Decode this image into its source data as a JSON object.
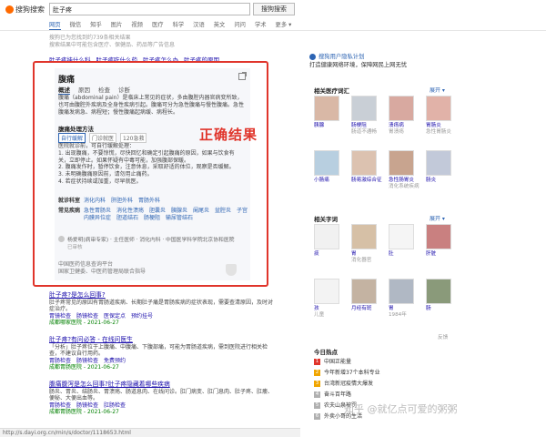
{
  "header": {
    "logo_text": "搜狗搜索",
    "search_value": "肚子疼",
    "search_button": "搜狗搜索",
    "tabs": [
      "网页",
      "微信",
      "知乎",
      "图片",
      "视频",
      "医疗",
      "科学",
      "汉语",
      "英文",
      "问问",
      "学术",
      "更多 ▾"
    ]
  },
  "notice": {
    "line1": "搜狗已为您找到约739条相关结果",
    "line2": "搜索结果中可能包含医疗、保健品、药品等广告信息",
    "links": [
      "肚子疼挂什么科",
      "肚子疼吃什么药",
      "肚子疼怎么办",
      "肚子疼的原因"
    ]
  },
  "card": {
    "title": "腹痛",
    "tabs": [
      "概述",
      "原因",
      "检查",
      "诊断"
    ],
    "desc": "腹痛（abdominal pain）是临床上常见的症状，多由腹腔内器官病变所致，也可由腹腔外疾病及全身性疾病引起。腹痛可分为急性腹痛与慢性腹痛。急性腹痛发病急、病程短；慢性腹痛起病缓、病程长。",
    "section_title": "腹痛处理方法",
    "pills": [
      "自行缓解",
      "门诊就医",
      "120急救"
    ],
    "body": "医院就诊前，可自行缓解处理：\n1. 出现腹痛，不要惊慌，尽快回忆和确定引起腹痛的原因，如果与饮食有关，立即停止。如果怀疑有中毒可能，加强腹部保暖。\n2. 腹痛发作时，暂停饮食，注意休息，采取舒适的体位，观察是否缓解。\n3. 未明确腹痛原因前，请勿用止痛药。\n4. 若症状持续或加重，尽早就医。",
    "correct_label": "正确结果",
    "dept_key": "就诊科室",
    "dept_value": "消化内科　肝胆外科　胃肠外科",
    "related_key": "常见疾病",
    "related_value": "急性胃肠炎　消化性溃疡　胆囊炎　胰腺炎　阑尾炎　盆腔炎　子宫内膜异位症　胆道结石　肠梗阻　输尿管结石",
    "doctor": "杨爱明(病审专家) · 主任医师 · 消化内科 · 中国医学科学院北京协和医院",
    "doctor_sub": "已审核",
    "source": "中国医药信息查询平台\n国家卫健委、中医药管理局联合指导"
  },
  "results": [
    {
      "title": "肚子疼?是怎么回事?",
      "desc": "肚子疼常见的原因有胃肠道疾病、长期肚子痛是胃肠疾病的症状表现，需要查清原因，及时对症治疗。",
      "links": [
        "胃镜检查",
        "肠镜检查",
        "医保定点",
        "预约挂号"
      ],
      "url": "成都哪家医院 - 2021-06-27"
    },
    {
      "title": "肚子疼?有问必答 - 在线问医生",
      "desc": "「分析」肚子疼位于上腹痛、中腹痛、下腹部痛，可能为胃肠道疾病，需到医院进行相关检查，不建议自行用药。",
      "links": [
        "胃肠检查",
        "肠镜检查",
        "免费预约"
      ],
      "url": "成都胃肠医院 - 2021-06-27"
    },
    {
      "title": "腹痛腹泻是怎么回事?肚子疼隐藏着哪些疾病",
      "desc": "肠炎、胃炎、结肠炎、胃溃疡、肠道息肉、在线问诊。肛门病变、肛门息肉、肚子疼、肛瘘、便秘、大便出血等。",
      "links": [
        "胃肠检查",
        "肠镜检查",
        "肛肠检查"
      ],
      "url": "成都胃肠医院 - 2021-06-27"
    }
  ],
  "right": {
    "follow_title": "搜狗用户隐私计划",
    "follow_desc": "打造健康网络环境，保障网民上网无忧",
    "related_title": "相关医疗词汇",
    "related_more": "展开 ▾",
    "related_items": [
      {
        "name": "胰腺",
        "sub": ""
      },
      {
        "name": "肠梗阻",
        "sub": "肠道不通畅"
      },
      {
        "name": "溃疡病",
        "sub": "胃溃疡"
      },
      {
        "name": "胃肠炎",
        "sub": "急性胃肠炎"
      },
      {
        "name": "小肠痛",
        "sub": ""
      },
      {
        "name": "肠易激综合征",
        "sub": ""
      },
      {
        "name": "急性肠胃炎",
        "sub": "消化系统疾病"
      },
      {
        "name": "肠炎",
        "sub": ""
      }
    ],
    "chars_title": "相关字词",
    "chars_more": "展开 ▾",
    "chars_items": [
      {
        "name": "痰",
        "sub": ""
      },
      {
        "name": "胃",
        "sub": "消化器官"
      },
      {
        "name": "肚",
        "sub": ""
      },
      {
        "name": "肝脏",
        "sub": ""
      },
      {
        "name": "孩",
        "sub": "儿童"
      },
      {
        "name": "月经有斑",
        "sub": ""
      },
      {
        "name": "胃",
        "sub": "1984年"
      },
      {
        "name": "肠",
        "sub": ""
      }
    ],
    "feedback": "反馈",
    "hot_title": "今日热点",
    "hot": [
      "中国正能量",
      "今年新增37个本科专业",
      "台湾新冠疫情大爆发",
      "奋斗百年路",
      "农夫山泉被罚",
      "外卖小哥的生活"
    ]
  },
  "watermark": "知乎 @就亿点可爱的粥粥",
  "status_url": "http://s.dayi.org.cn/min/s/doctor/1118653.html"
}
